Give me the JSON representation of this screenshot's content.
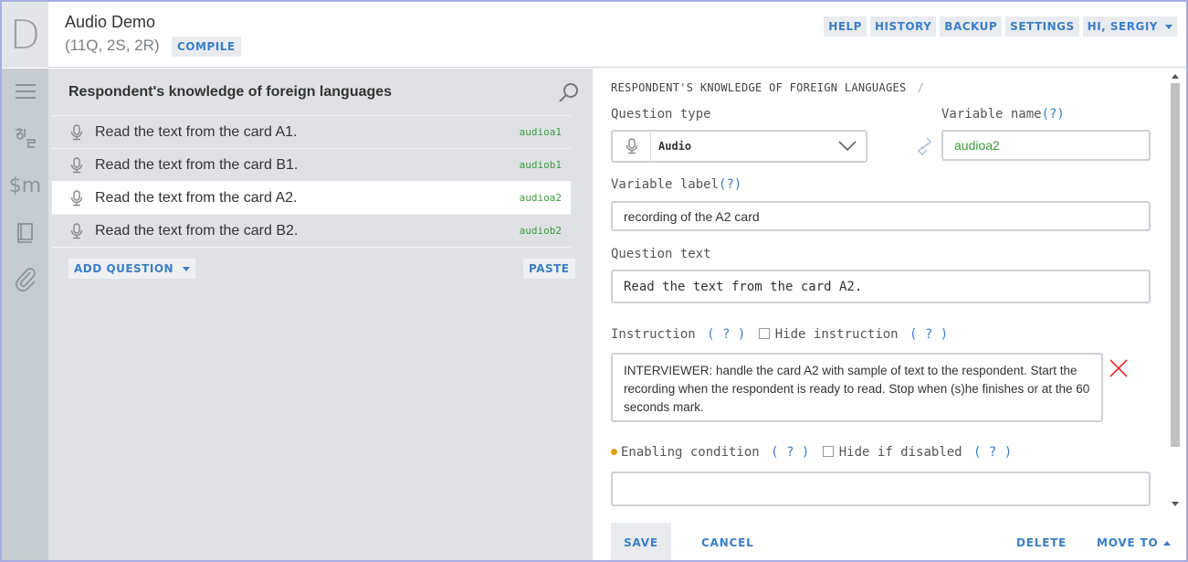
{
  "header": {
    "logo": "D",
    "title": "Audio Demo",
    "counts": "(11Q, 2S, 2R)",
    "compile_label": "COMPILE",
    "nav": {
      "help": "HELP",
      "history": "HISTORY",
      "backup": "BACKUP",
      "settings": "SETTINGS",
      "user": "HI, SERGIY"
    }
  },
  "rail": {
    "icons": [
      "menu-icon",
      "translate-icon",
      "macros-icon",
      "lookup-tables-icon",
      "attachments-icon"
    ]
  },
  "section": {
    "title": "Respondent's knowledge of foreign languages",
    "questions": [
      {
        "text": "Read the text from the card A1.",
        "variable": "audioa1"
      },
      {
        "text": "Read the text from the card B1.",
        "variable": "audiob1"
      },
      {
        "text": "Read the text from the card A2.",
        "variable": "audioa2"
      },
      {
        "text": "Read the text from the card B2.",
        "variable": "audiob2"
      }
    ],
    "selected_index": 2,
    "add_question_label": "ADD QUESTION",
    "paste_label": "PASTE"
  },
  "editor": {
    "breadcrumb": "RESPONDENT'S KNOWLEDGE OF FOREIGN LANGUAGES",
    "breadcrumb_sep": "/",
    "question_type_label": "Question type",
    "question_type_value": "Audio",
    "variable_name_label": "Variable name",
    "variable_name_value": "audioa2",
    "variable_label_label": "Variable label",
    "variable_label_value": "recording of the A2 card",
    "question_text_label": "Question text",
    "question_text_value": "Read the text from the card A2.",
    "instruction_label": "Instruction",
    "hide_instruction_label": "Hide instruction",
    "instruction_value": "INTERVIEWER: handle the card A2 with sample of text to the respondent. Start the recording when the respondent is ready to read. Stop when (s)he finishes or at the 60 seconds mark.",
    "enabling_condition_label": "Enabling condition",
    "hide_if_disabled_label": "Hide if disabled",
    "enabling_condition_value": "",
    "help_mark": "(?)",
    "help_mark_spaced": "( ? )",
    "buttons": {
      "save": "SAVE",
      "cancel": "CANCEL",
      "delete": "DELETE",
      "move_to": "MOVE TO"
    }
  },
  "colors": {
    "accent": "#3b7ec9",
    "variable_green": "#3a9a3a",
    "rail_bg": "#c7ccd1",
    "panel_bg": "#dfe2e5",
    "remove_red": "#e03030",
    "condition_dot": "#e0a000"
  }
}
